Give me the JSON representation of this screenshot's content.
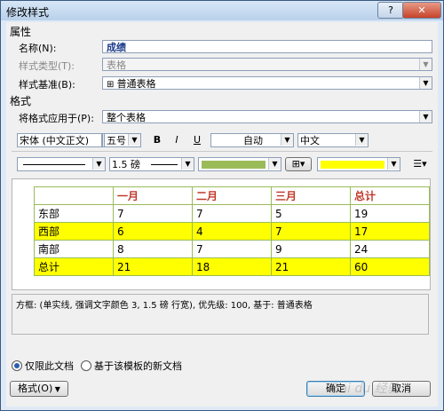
{
  "window": {
    "title": "修改样式",
    "help": "?",
    "close": "✕"
  },
  "properties": {
    "heading": "属性",
    "name_label": "名称(N):",
    "name_value": "成绩",
    "type_label": "样式类型(T):",
    "type_value": "表格",
    "base_label": "样式基准(B):",
    "base_value": "普通表格"
  },
  "format": {
    "heading": "格式",
    "apply_label": "将格式应用于(P):",
    "apply_value": "整个表格",
    "font": "宋体 (中文正文)",
    "size": "五号",
    "bold": "B",
    "italic": "I",
    "underline": "U",
    "color": "自动",
    "script": "中文",
    "line_style": "",
    "line_width": "1.5 磅",
    "shading_color": "#9bbb59",
    "fill_color": "#ffff00"
  },
  "preview_table": {
    "header": [
      "",
      "一月",
      "二月",
      "三月",
      "总计"
    ],
    "rows": [
      [
        "东部",
        "7",
        "7",
        "5",
        "19"
      ],
      [
        "西部",
        "6",
        "4",
        "7",
        "17"
      ],
      [
        "南部",
        "8",
        "7",
        "9",
        "24"
      ],
      [
        "总计",
        "21",
        "18",
        "21",
        "60"
      ]
    ]
  },
  "description": "方框: (单实线, 强调文字颜色 3, 1.5 磅 行宽), 优先级: 100, 基于: 普通表格",
  "options": {
    "only_doc": "仅限此文档",
    "new_docs": "基于该模板的新文档"
  },
  "buttons": {
    "format": "格式(O)",
    "ok": "确定",
    "cancel": "取消"
  },
  "watermark": "Bai du 经验"
}
